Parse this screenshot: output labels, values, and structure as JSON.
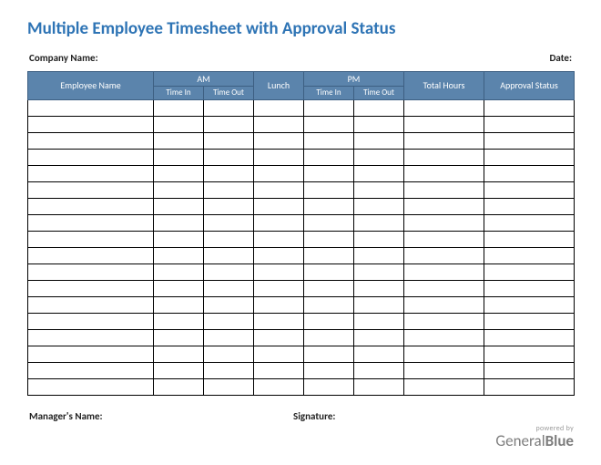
{
  "title": "Multiple Employee Timesheet with Approval Status",
  "labels": {
    "company_name": "Company Name:",
    "date": "Date:",
    "managers_name": "Manager's Name:",
    "signature": "Signature:"
  },
  "columns": {
    "employee_name": "Employee Name",
    "am": "AM",
    "pm": "PM",
    "lunch": "Lunch",
    "time_in": "Time In",
    "time_out": "Time Out",
    "total_hours": "Total Hours",
    "approval_status": "Approval Status"
  },
  "branding": {
    "powered_by": "powered by",
    "general": "General",
    "blue": "Blue"
  },
  "row_count": 18,
  "colors": {
    "title": "#2e74b5",
    "header_bg": "#5b84ac",
    "header_border": "#3d5f82"
  }
}
